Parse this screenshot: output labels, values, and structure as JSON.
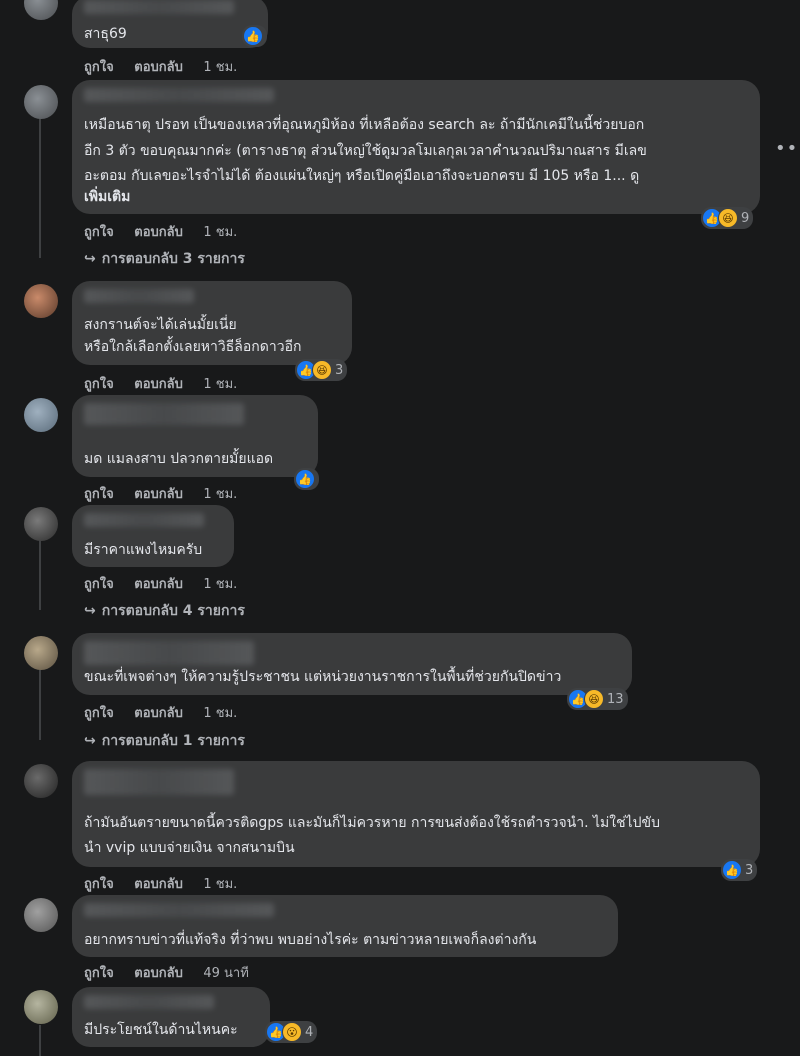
{
  "actions": {
    "like": "ถูกใจ",
    "reply": "ตอบกลับ"
  },
  "comments": [
    {
      "lines": [
        "สาธุ69"
      ],
      "time": "1 ชม.",
      "reactions": "",
      "reaction_icons": [
        "like-icon"
      ]
    },
    {
      "lines": [
        "เหมือนธาตุ ปรอท เป็นของเหลวที่อุณหภูมิห้อง ที่เหลือต้อง search ละ ถ้ามีนักเคมีในนี้ช่วยบอก",
        "อีก 3 ตัว ขอบคุณมากค่ะ (ตารางธาตุ ส่วนใหญ่ใช้ดูมวลโมเลกุลเวลาคำนวณปริมาณสาร มีเลข",
        "อะตอม กับเลขอะไรจำไม่ได้ ต้องแผ่นใหญ่ๆ หรือเปิดคู่มือเอาถึงจะบอกครบ มี 105 หรือ 1... ดู"
      ],
      "see_more": "เพิ่มเติม",
      "time": "1 ชม.",
      "reactions": "9",
      "reaction_icons": [
        "like-icon",
        "haha-icon"
      ],
      "replies": "การตอบกลับ 3 รายการ"
    },
    {
      "lines": [
        "สงกรานต์จะได้เล่นมั้ยเนี่ย",
        "หรือใกล้เลือกตั้งเลยหาวิธีล็อกดาวอีก"
      ],
      "time": "1 ชม.",
      "reactions": "3",
      "reaction_icons": [
        "like-icon",
        "haha-icon"
      ]
    },
    {
      "lines": [
        "มด แมลงสาบ ปลวกตายมั้ยแอด"
      ],
      "time": "1 ชม.",
      "reactions": "",
      "reaction_icons": [
        "like-icon"
      ]
    },
    {
      "lines": [
        "มีราคาแพงไหมครับ"
      ],
      "time": "1 ชม.",
      "replies": "การตอบกลับ 4 รายการ"
    },
    {
      "lines": [
        "ขณะที่เพจต่างๆ ให้ความรู้ประชาชน แต่หน่วยงานราชการในพื้นที่ช่วยกันปิดข่าว"
      ],
      "time": "1 ชม.",
      "reactions": "13",
      "reaction_icons": [
        "like-icon",
        "haha-icon"
      ],
      "replies": "การตอบกลับ 1 รายการ"
    },
    {
      "lines": [
        "ถ้ามันอันตรายขนาดนี้ควรติดgps และมันก็ไม่ควรหาย การขนส่งต้องใช้รถตำรวจนำ. ไม่ใช่ไปขับ",
        "นำ vvip แบบจ่ายเงิน จากสนามบิน"
      ],
      "time": "1 ชม.",
      "reactions": "3",
      "reaction_icons": [
        "like-icon"
      ]
    },
    {
      "lines": [
        "อยากทราบข่าวที่แท้จริง ที่ว่าพบ พบอย่างไรค่ะ ตามข่าวหลายเพจก็ลงต่างกัน"
      ],
      "time": "49 นาที"
    },
    {
      "lines": [
        "มีประโยชน์ในด้านไหนคะ"
      ],
      "reactions": "4",
      "reaction_icons": [
        "like-icon",
        "wow-icon"
      ]
    }
  ]
}
